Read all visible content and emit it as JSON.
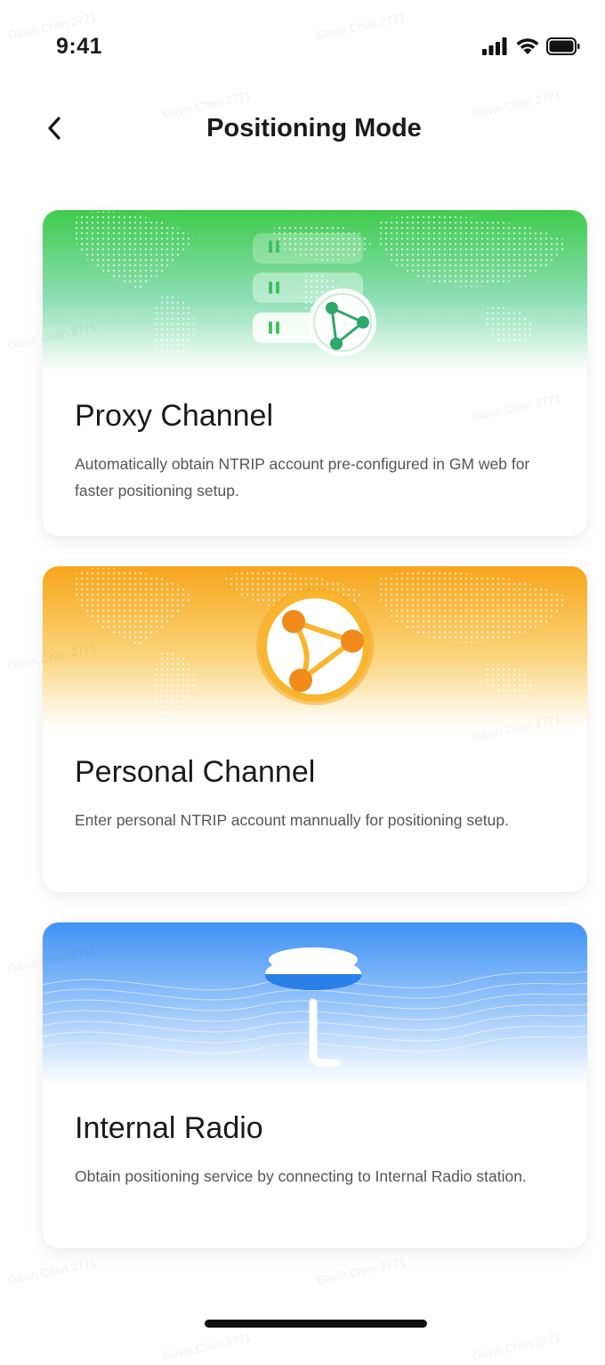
{
  "status_bar": {
    "time": "9:41",
    "icons": [
      "signal-icon",
      "wifi-icon",
      "battery-icon"
    ]
  },
  "nav": {
    "back_icon": "chevron-left-icon",
    "title": "Positioning Mode"
  },
  "cards": [
    {
      "title": "Proxy Channel",
      "description": "Automatically obtain NTRIP account pre-configured in GM web for faster positioning setup.",
      "illustration": "server-globe-icon",
      "accent": "#3cc95a"
    },
    {
      "title": "Personal Channel",
      "description": "Enter personal NTRIP account mannually for positioning setup.",
      "illustration": "globe-network-icon",
      "accent": "#f6a81c"
    },
    {
      "title": "Internal Radio",
      "description": "Obtain positioning service by connecting to Internal Radio station.",
      "illustration": "radio-antenna-icon",
      "accent": "#3d8ef5"
    }
  ],
  "watermark": "Gavin.Chen 2771"
}
